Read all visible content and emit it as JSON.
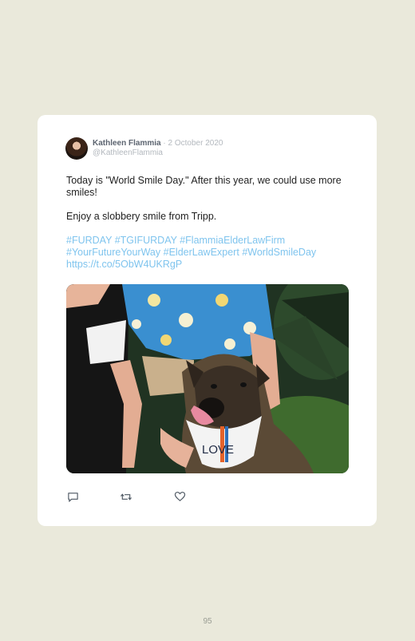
{
  "tweet": {
    "author_name": "Kathleen Flammia",
    "separator": "·",
    "date": "2 October 2020",
    "handle": "@KathleenFlammia",
    "paragraph_1": "Today is \"World Smile Day.\" After this year, we could use more smiles!",
    "paragraph_2": "Enjoy a slobbery smile from Tripp.",
    "hashtags": [
      "#FURDAY",
      "#TGIFURDAY",
      "#FlammiaElderLawFirm",
      "#YourFutureYourWay",
      "#ElderLawExpert",
      "#WorldSmileDay"
    ],
    "link": "https://t.co/5ObW4UKRgP",
    "bandana_text": "LOVE",
    "actions": {
      "reply_icon": "reply-icon",
      "retweet_icon": "retweet-icon",
      "like_icon": "heart-icon"
    }
  },
  "footer": {
    "page_number": "95"
  },
  "colors": {
    "page_background": "#eae9db",
    "card_background": "#ffffff",
    "author_name": "#5c6470",
    "muted": "#b3b8be",
    "hashtag": "#7fc4ee",
    "icon": "#4b5560"
  }
}
